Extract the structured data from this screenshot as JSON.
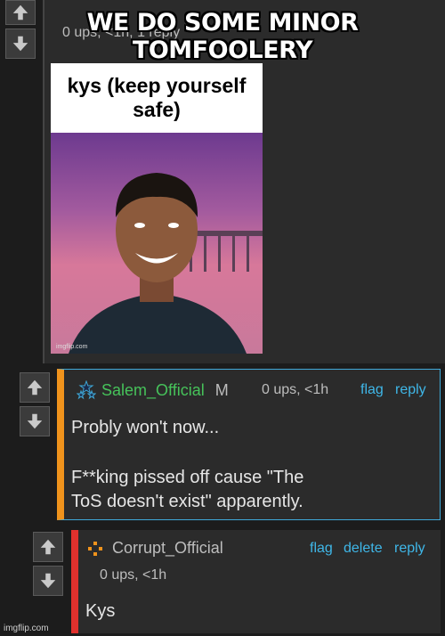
{
  "caption": "WE DO SOME MINOR TOMFOOLERY",
  "top_comment": {
    "meta": "0 ups, <1h, 1 reply",
    "image": {
      "text": "kys (keep yourself safe)",
      "watermark": "imgflip.com"
    }
  },
  "reply1": {
    "username": "Salem_Official",
    "badge": "M",
    "meta": "0 ups, <1h",
    "actions": {
      "flag": "flag",
      "reply": "reply"
    },
    "body_line1": "Probly won't now...",
    "body_line2": "F**king pissed off cause \"The ToS doesn't exist\" apparently.",
    "accent": "#f0931c",
    "username_color": "#46c25a"
  },
  "reply2": {
    "username": "Corrupt_Official",
    "meta": "0 ups, <1h",
    "actions": {
      "flag": "flag",
      "delete": "delete",
      "reply": "reply"
    },
    "body": "Kys",
    "accent": "#e0312d"
  },
  "footer": {
    "watermark": "imgflip.com"
  },
  "icons": [
    "arrow-up-icon",
    "arrow-down-icon",
    "stars-icon",
    "dots-icon"
  ]
}
